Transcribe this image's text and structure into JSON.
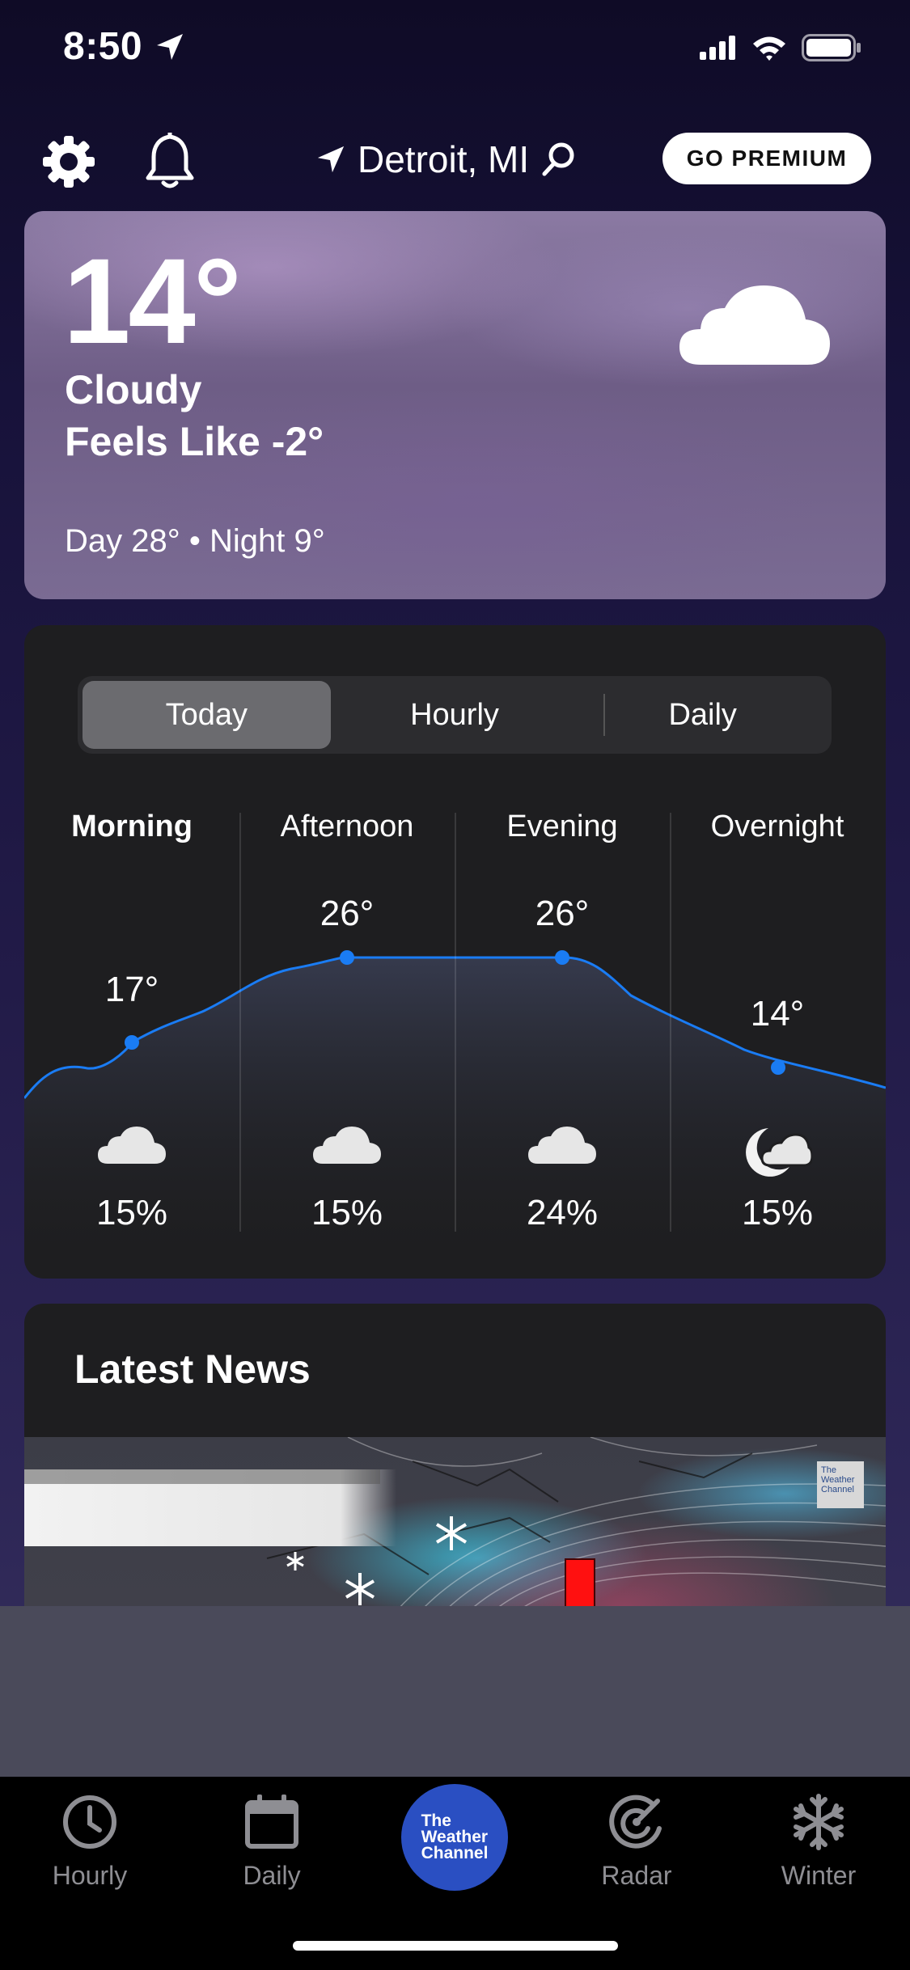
{
  "status_bar": {
    "time": "8:50"
  },
  "top_nav": {
    "location": "Detroit, MI",
    "premium_label": "GO PREMIUM"
  },
  "current": {
    "temperature": "14°",
    "condition": "Cloudy",
    "feels_like": "Feels Like -2°",
    "day_night": "Day 28° • Night 9°",
    "icon": "cloud-icon"
  },
  "forecast": {
    "tabs": [
      {
        "label": "Today",
        "active": true
      },
      {
        "label": "Hourly",
        "active": false
      },
      {
        "label": "Daily",
        "active": false
      }
    ],
    "periods": [
      {
        "name": "Morning",
        "temp": "17°",
        "temp_value": 17,
        "precip": "15%",
        "icon": "cloud-icon"
      },
      {
        "name": "Afternoon",
        "temp": "26°",
        "temp_value": 26,
        "precip": "15%",
        "icon": "cloud-icon"
      },
      {
        "name": "Evening",
        "temp": "26°",
        "temp_value": 26,
        "precip": "24%",
        "icon": "cloud-icon"
      },
      {
        "name": "Overnight",
        "temp": "14°",
        "temp_value": 14,
        "precip": "15%",
        "icon": "moon-cloud-icon"
      }
    ],
    "line_color": "#1a7cf4"
  },
  "news": {
    "title": "Latest News",
    "logo_text": "The Weather Channel"
  },
  "tab_bar": {
    "items": [
      {
        "label": "Hourly",
        "icon": "clock-icon"
      },
      {
        "label": "Daily",
        "icon": "calendar-icon"
      },
      {
        "label": "Radar",
        "icon": "radar-icon"
      },
      {
        "label": "Winter",
        "icon": "snowflake-icon"
      }
    ],
    "center_logo_text": "The\nWeather\nChannel",
    "brand_color": "#2a4fc2"
  }
}
